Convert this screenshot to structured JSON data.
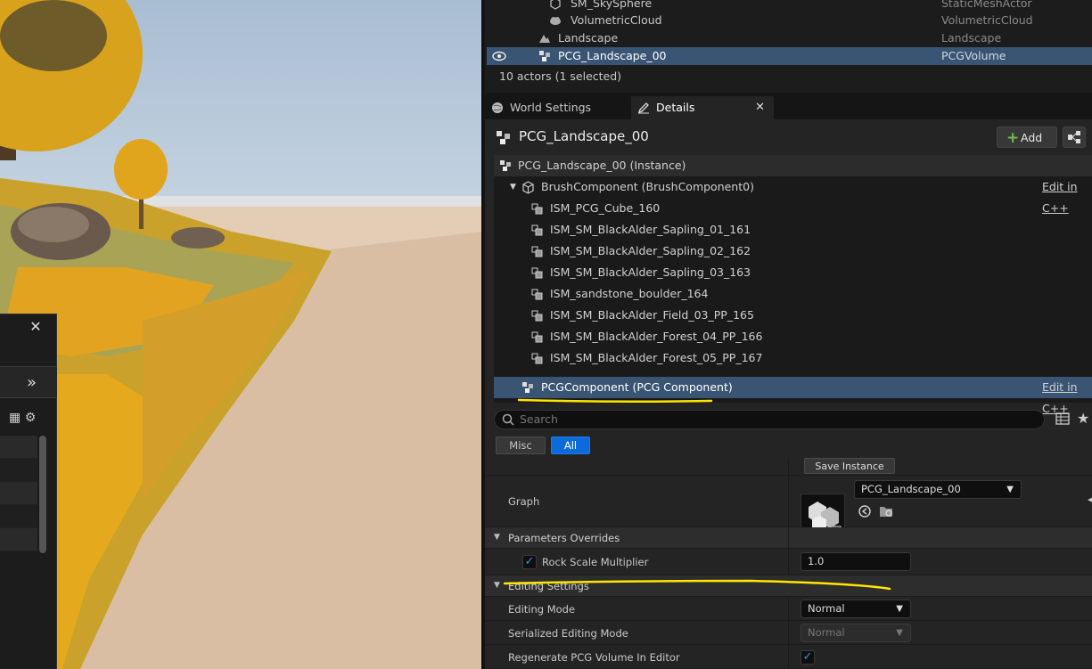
{
  "outliner": {
    "rows": [
      {
        "name": "SM_SkySphere",
        "type": "StaticMeshActor",
        "icon": "static-mesh-icon"
      },
      {
        "name": "VolumetricCloud",
        "type": "VolumetricCloud",
        "icon": "cloud-icon"
      },
      {
        "name": "Landscape",
        "type": "Landscape",
        "icon": "landscape-icon"
      },
      {
        "name": "PCG_Landscape_00",
        "type": "PCGVolume",
        "icon": "pcg-icon",
        "selected": true
      }
    ],
    "actor_count": "10 actors (1 selected)"
  },
  "tabs": [
    {
      "label": "World Settings",
      "icon": "globe-icon"
    },
    {
      "label": "Details",
      "icon": "pencil-icon",
      "active": true
    }
  ],
  "details": {
    "actor_name": "PCG_Landscape_00",
    "add_label": "Add",
    "components": {
      "root": "PCG_Landscape_00 (Instance)",
      "brush": "BrushComponent (BrushComponent0)",
      "edit_cpp": "Edit in C++",
      "children": [
        "ISM_PCG_Cube_160",
        "ISM_SM_BlackAlder_Sapling_01_161",
        "ISM_SM_BlackAlder_Sapling_02_162",
        "ISM_SM_BlackAlder_Sapling_03_163",
        "ISM_sandstone_boulder_164",
        "ISM_SM_BlackAlder_Field_03_PP_165",
        "ISM_SM_BlackAlder_Forest_04_PP_166",
        "ISM_SM_BlackAlder_Forest_05_PP_167"
      ],
      "pcg": "PCGComponent (PCG Component)"
    },
    "search_placeholder": "Search",
    "filters": {
      "misc": "Misc",
      "all": "All"
    },
    "props": {
      "save_instance": "Save Instance",
      "graph_label": "Graph",
      "graph_value": "PCG_Landscape_00",
      "params_overrides": "Parameters Overrides",
      "rock_scale_label": "Rock Scale Multiplier",
      "rock_scale_value": "1.0",
      "editing_settings": "Editing Settings",
      "editing_mode_label": "Editing Mode",
      "editing_mode_value": "Normal",
      "serialized_mode_label": "Serialized Editing Mode",
      "serialized_mode_value": "Normal",
      "regenerate_label": "Regenerate PCG Volume In Editor"
    }
  },
  "colors": {
    "selection": "#3a5573",
    "accent_blue": "#0d6adb",
    "annotation": "#ffe600",
    "add_plus": "#6fbd4e"
  }
}
